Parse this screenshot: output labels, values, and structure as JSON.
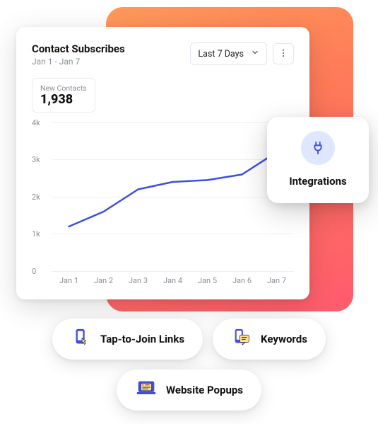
{
  "card": {
    "title": "Contact Subscribes",
    "subtitle": "Jan 1 - Jan 7",
    "dropdown_label": "Last 7 Days",
    "stat_label": "New Contacts",
    "stat_value": "1,938"
  },
  "integrations": {
    "label": "Integrations",
    "icon": "plug-icon"
  },
  "pills": [
    {
      "icon": "phone-tap-icon",
      "label": "Tap-to-Join Links"
    },
    {
      "icon": "phone-chat-icon",
      "label": "Keywords"
    },
    {
      "icon": "laptop-popup-icon",
      "label": "Website Popups"
    }
  ],
  "colors": {
    "line": "#3d4ee0",
    "grid": "#eef0f3",
    "axis_text": "#8a8f98"
  },
  "chart_data": {
    "type": "line",
    "title": "Contact Subscribes",
    "categories": [
      "Jan 1",
      "Jan 2",
      "Jan 3",
      "Jan 4",
      "Jan 5",
      "Jan 6",
      "Jan 7"
    ],
    "values": [
      1200,
      1600,
      2200,
      2400,
      2450,
      2600,
      3200
    ],
    "xlabel": "",
    "ylabel": "",
    "ylim": [
      0,
      4000
    ],
    "yticks": [
      0,
      1000,
      2000,
      3000,
      4000
    ],
    "ytick_labels": [
      "0",
      "1k",
      "2k",
      "3k",
      "4k"
    ]
  }
}
